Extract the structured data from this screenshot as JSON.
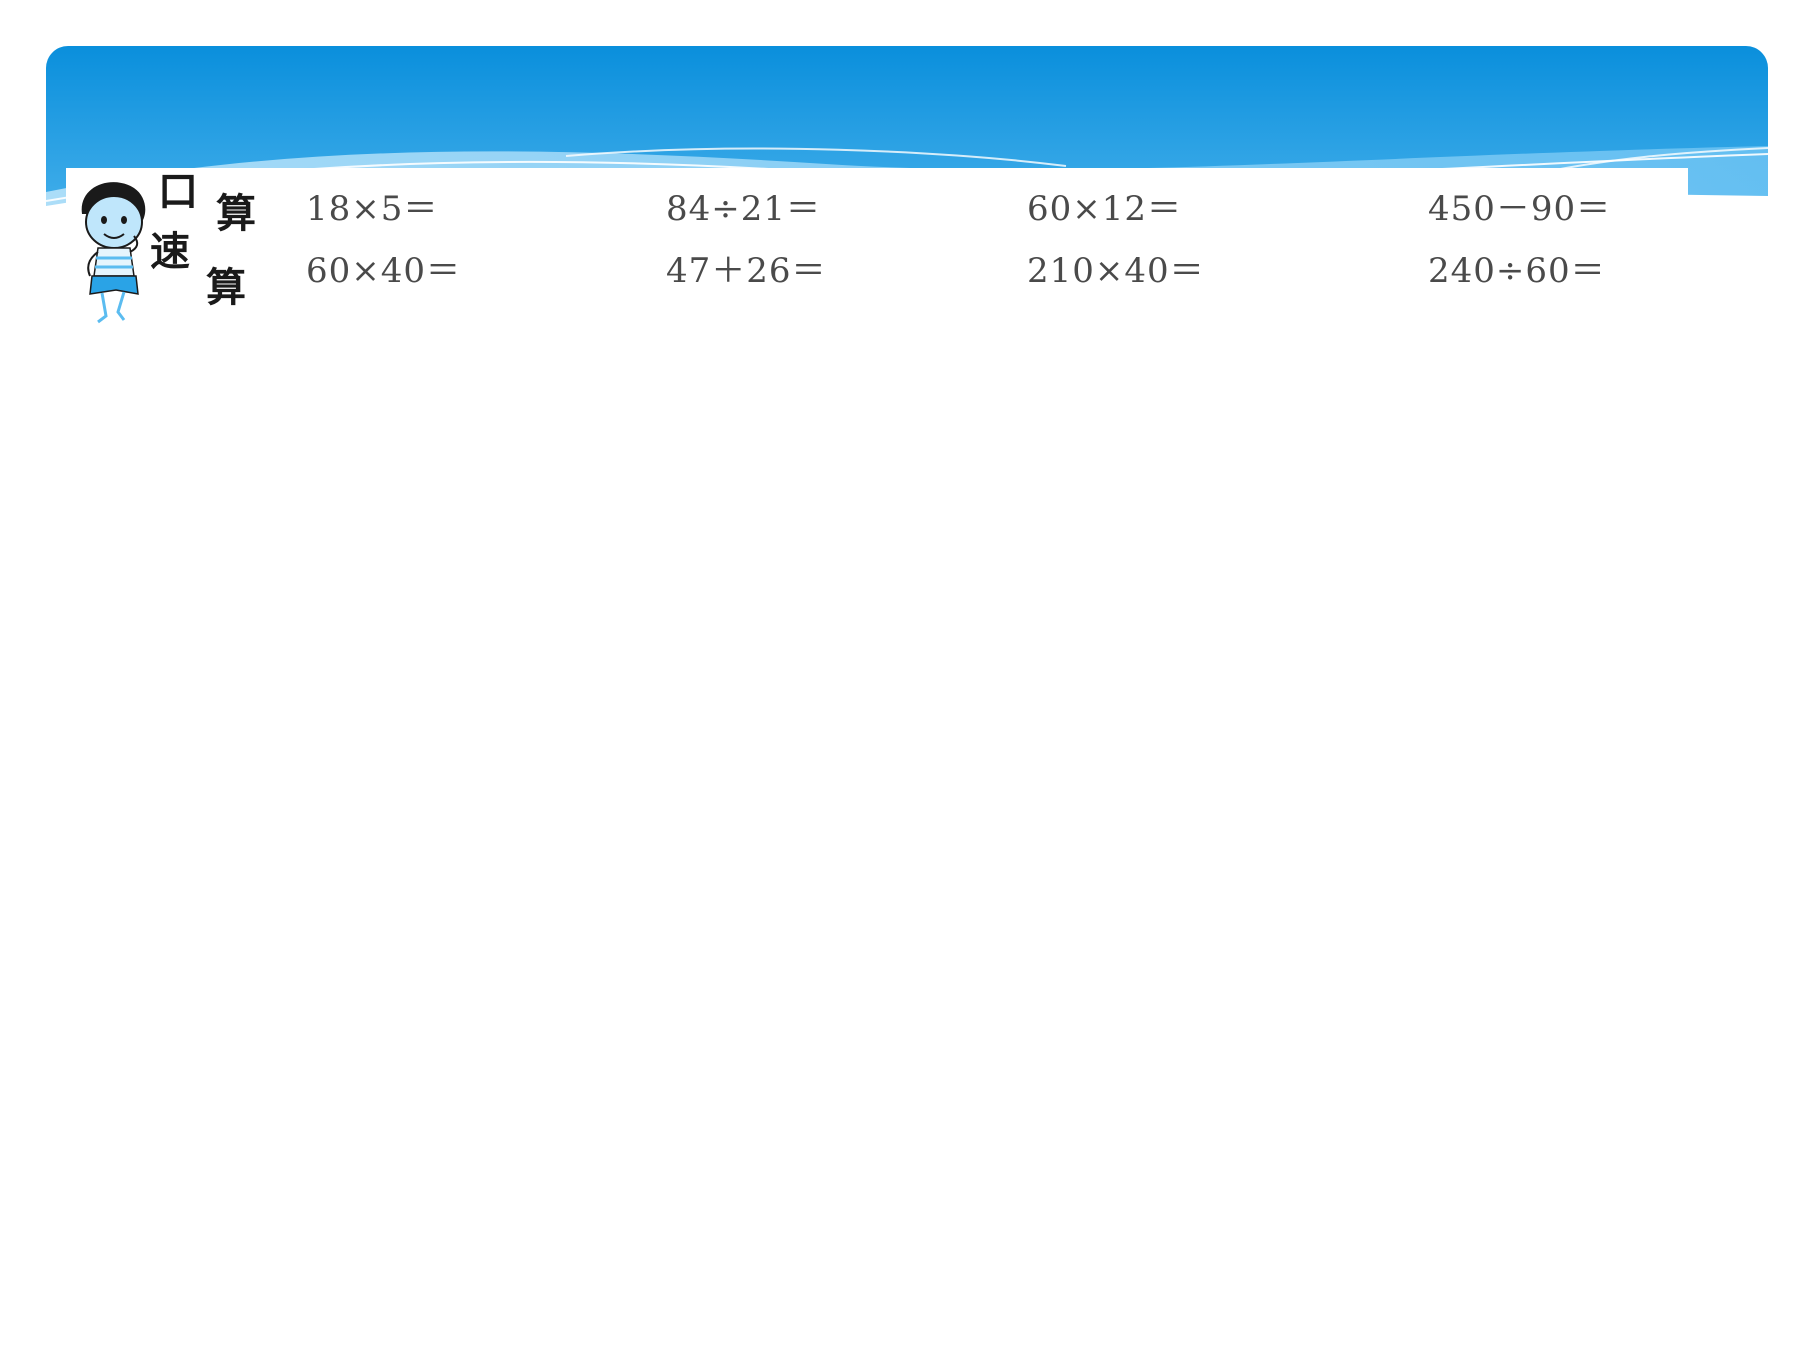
{
  "theme": {
    "header_color_top": "#0a8fdc",
    "header_color_bottom": "#7cc9f4",
    "text_color": "#4a4a4a"
  },
  "heading": {
    "chars": [
      "口",
      "算",
      "速",
      "算"
    ],
    "mascot_icon": "cartoon-boy-icon"
  },
  "problems": [
    [
      "18×5＝",
      "84÷21＝",
      "60×12＝",
      "450－90＝"
    ],
    [
      "60×40＝",
      "47＋26＝",
      "210×40＝",
      "240÷60＝"
    ]
  ]
}
